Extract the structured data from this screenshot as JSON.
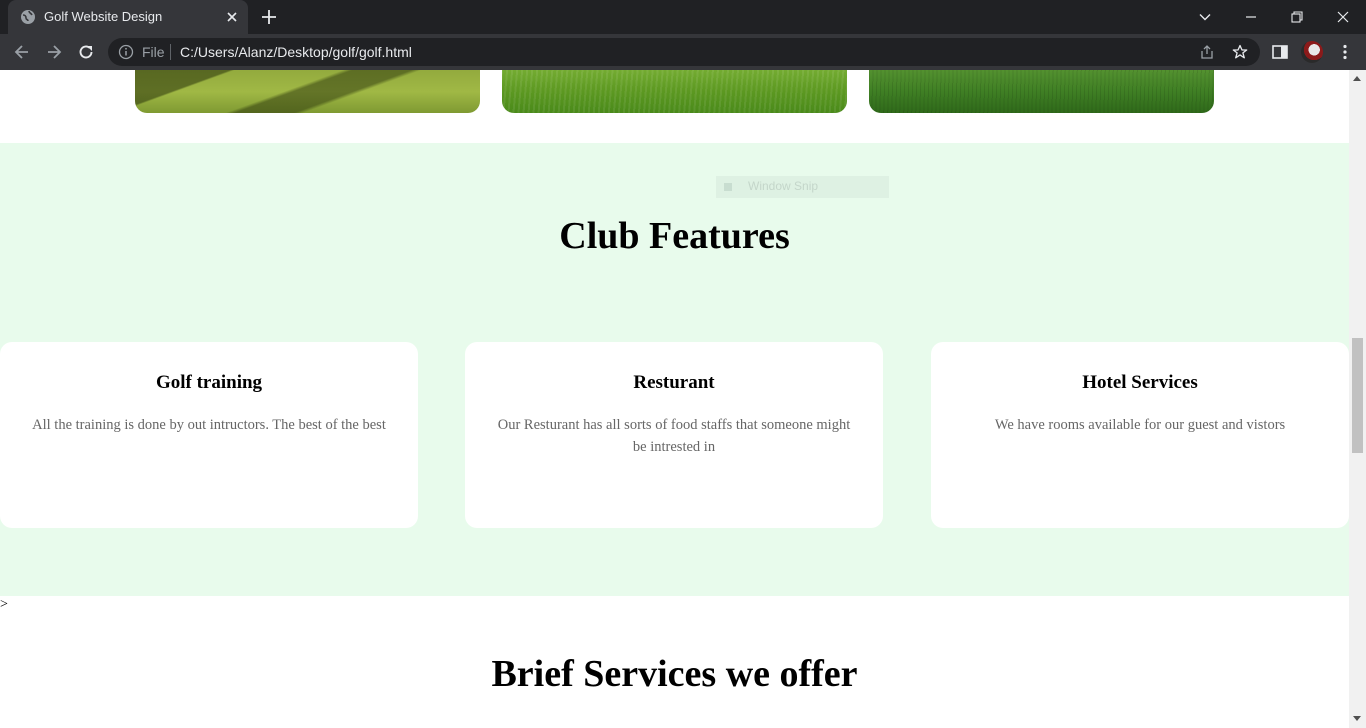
{
  "browser": {
    "tab_title": "Golf Website Design",
    "scheme_label": "File",
    "url": "C:/Users/Alanz/Desktop/golf/golf.html"
  },
  "overlay": {
    "snip_label": "Window Snip"
  },
  "features": {
    "title": "Club Features",
    "cards": [
      {
        "title": "Golf training",
        "text": "All the training is done by out intructors. The best of the best"
      },
      {
        "title": "Resturant",
        "text": "Our Resturant has all sorts of food staffs that someone might be intrested in"
      },
      {
        "title": "Hotel Services",
        "text": "We have rooms available for our guest and vistors"
      }
    ]
  },
  "stray_text": ">",
  "services": {
    "title": "Brief Services we offer"
  }
}
